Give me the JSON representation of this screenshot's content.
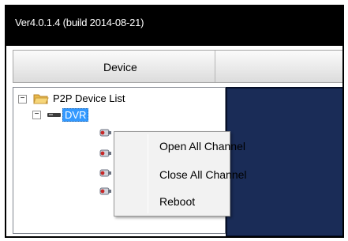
{
  "window": {
    "title": "Ver4.0.1.4 (build 2014-08-21)"
  },
  "toolbar": {
    "device_label": "Device"
  },
  "tree": {
    "root_label": "P2P Device List",
    "root_expander": "−",
    "dvr_label": "DVR",
    "dvr_expander": "−"
  },
  "context_menu": {
    "items": [
      {
        "label": "Open All Channel"
      },
      {
        "label": "Close All Channel"
      },
      {
        "label": "Reboot"
      }
    ]
  },
  "colors": {
    "selection": "#3399ff",
    "video_panel": "#1a2c57",
    "title_bar": "#000000"
  }
}
